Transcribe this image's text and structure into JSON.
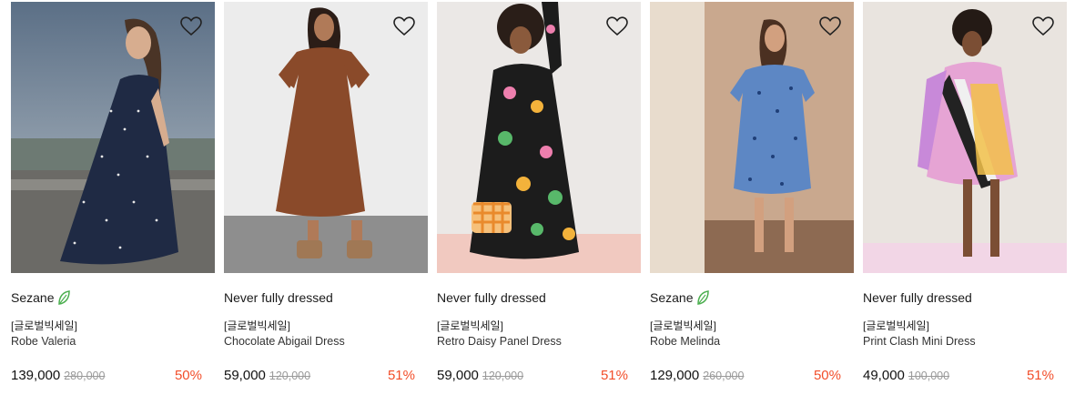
{
  "products": [
    {
      "brand": "Sezane",
      "eco": true,
      "tag": "[글로벌빅세일]",
      "name": "Robe Valeria",
      "price": "139,000",
      "original_price": "280,000",
      "discount": "50%"
    },
    {
      "brand": "Never fully dressed",
      "eco": false,
      "tag": "[글로벌빅세일]",
      "name": "Chocolate Abigail Dress",
      "price": "59,000",
      "original_price": "120,000",
      "discount": "51%"
    },
    {
      "brand": "Never fully dressed",
      "eco": false,
      "tag": "[글로벌빅세일]",
      "name": "Retro Daisy Panel Dress",
      "price": "59,000",
      "original_price": "120,000",
      "discount": "51%"
    },
    {
      "brand": "Sezane",
      "eco": true,
      "tag": "[글로벌빅세일]",
      "name": "Robe Melinda",
      "price": "129,000",
      "original_price": "260,000",
      "discount": "50%"
    },
    {
      "brand": "Never fully dressed",
      "eco": false,
      "tag": "[글로벌빅세일]",
      "name": "Print Clash Mini Dress",
      "price": "49,000",
      "original_price": "100,000",
      "discount": "51%"
    }
  ],
  "colors": {
    "discount": "#f24e2a",
    "eco_leaf": "#4caf50"
  },
  "icons": {
    "wishlist": "heart-outline-icon",
    "eco": "leaf-icon"
  }
}
